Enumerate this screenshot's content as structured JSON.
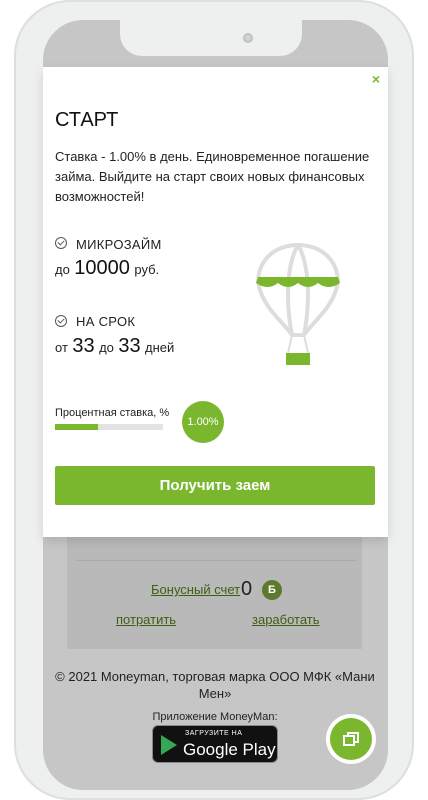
{
  "modal": {
    "close_label": "×",
    "title": "СТАРТ",
    "description": "Ставка - 1.00% в день. Единовременное погашение займа. Выйдите на старт своих новых финансовых возможностей!",
    "loan": {
      "label": "МИКРОЗАЙМ",
      "prefix": "до",
      "amount": "10000",
      "unit": "руб."
    },
    "term": {
      "label": "НА СРОК",
      "from_word": "от",
      "from": "33",
      "to_word": "до",
      "to": "33",
      "unit": "дней"
    },
    "rate": {
      "label": "Процентная ставка, %",
      "value": "1.00%",
      "fill_fraction": 0.4
    },
    "cta_label": "Получить заем"
  },
  "bonus": {
    "label": "Бонусный счет",
    "value": "0",
    "badge": "Б",
    "spend_label": "потратить",
    "earn_label": "заработать"
  },
  "footer": {
    "copyright": "© 2021 Moneyman, торговая марка ООО МФК «Мани Мен»",
    "app_label": "Приложение MoneyMan:"
  },
  "store_badge": {
    "small": "ЗАГРУЗИТЕ НА",
    "big": "Google Play"
  },
  "colors": {
    "accent": "#7ab72e",
    "link": "#3d5f12"
  },
  "icons": {
    "close": "close-icon",
    "check": "check-circle-icon",
    "balloon": "hot-air-balloon-icon",
    "chat": "chat-icon",
    "play": "google-play-icon"
  }
}
